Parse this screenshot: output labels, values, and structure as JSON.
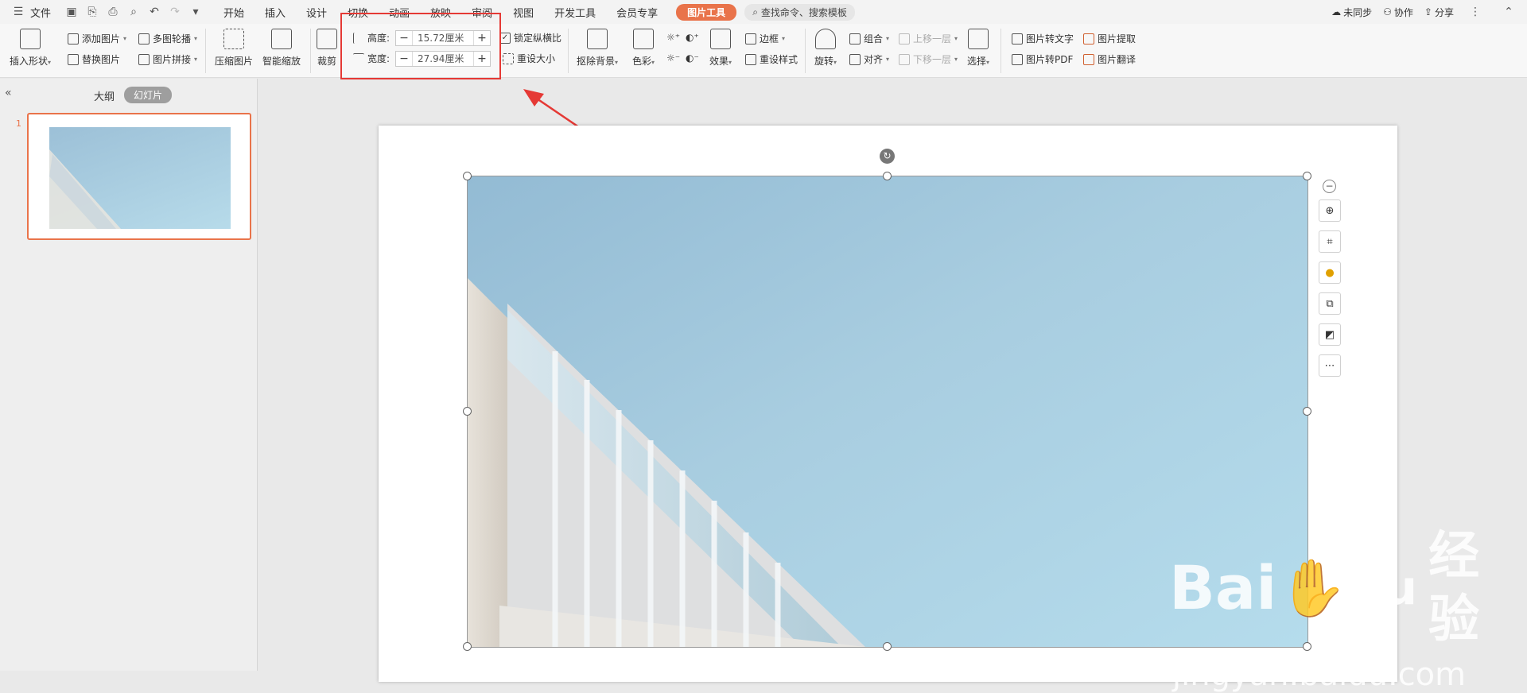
{
  "menubar": {
    "file": "文件",
    "tabs": [
      "开始",
      "插入",
      "设计",
      "切换",
      "动画",
      "放映",
      "审阅",
      "视图",
      "开发工具",
      "会员专享"
    ],
    "picture_tools": "图片工具",
    "search": "查找命令、搜索模板",
    "unsynced": "未同步",
    "collab": "协作",
    "share": "分享"
  },
  "ribbon": {
    "insert_shape": "插入形状",
    "add_picture": "添加图片",
    "replace_picture": "替换图片",
    "multi_carousel": "多图轮播",
    "picture_stitch": "图片拼接",
    "compress": "压缩图片",
    "smart_zoom": "智能缩放",
    "crop": "裁剪",
    "height_label": "高度:",
    "height_value": "15.72厘米",
    "width_label": "宽度:",
    "width_value": "27.94厘米",
    "lock_ratio": "锁定纵横比",
    "reset_size": "重设大小",
    "remove_bg": "抠除背景",
    "color": "色彩",
    "effect": "效果",
    "border": "边框",
    "reset_style": "重设样式",
    "rotate": "旋转",
    "group": "组合",
    "align": "对齐",
    "bring_forward": "上移一层",
    "send_backward": "下移一层",
    "select": "选择",
    "pic_to_text": "图片转文字",
    "pic_to_pdf": "图片转PDF",
    "pic_extract": "图片提取",
    "pic_translate": "图片翻译"
  },
  "left_pane": {
    "outline_tab": "大纲",
    "slides_tab": "幻灯片",
    "slide_number": "1"
  },
  "watermark": {
    "brand": "Bai",
    "brand2": "du",
    "cn": "经验",
    "url": "jingyan.baidu.com"
  },
  "colors": {
    "accent": "#e9734a",
    "highlight": "#e53935",
    "sky": "#a8cde0"
  }
}
